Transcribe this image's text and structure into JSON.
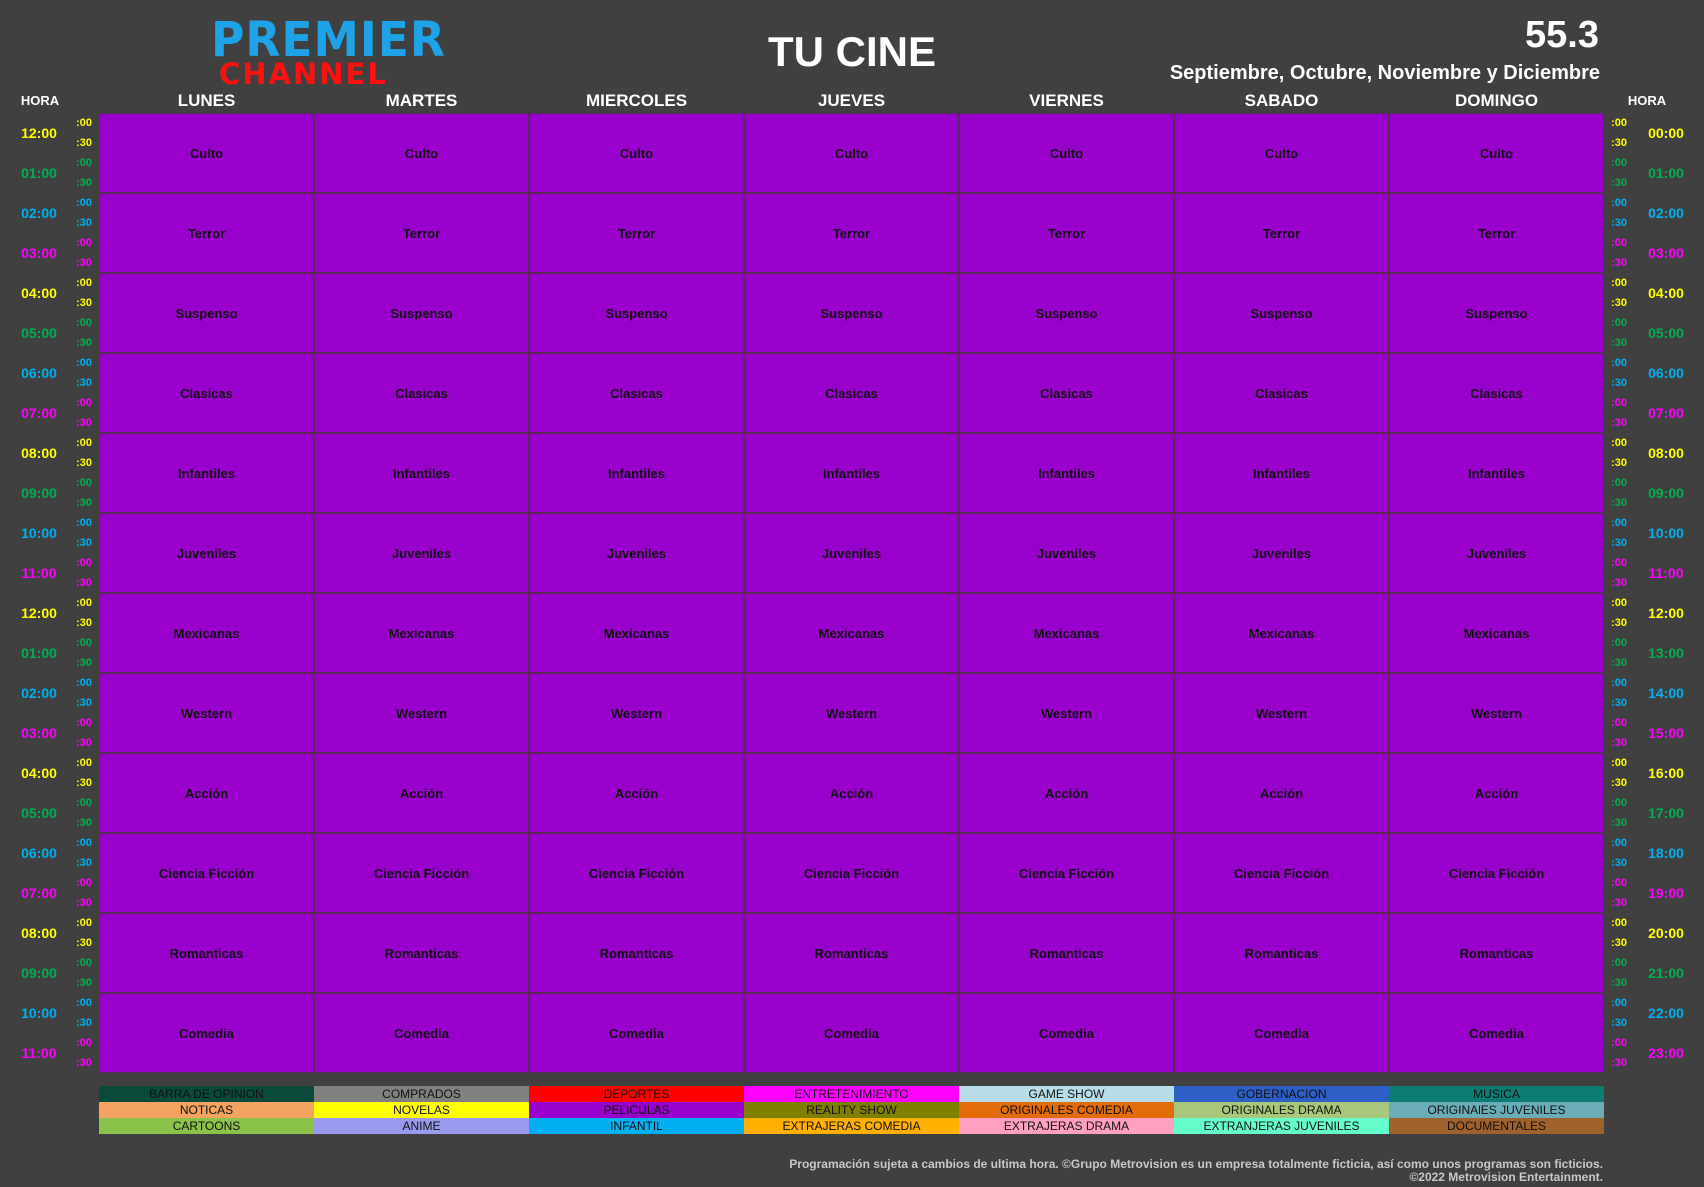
{
  "header": {
    "logo_line1": "PREMIER",
    "logo_line2": "CHANNEL",
    "title": "TU CINE",
    "channel_number": "55.3",
    "months": "Septiembre, Octubre, Noviembre y Diciembre"
  },
  "hora_label": "HORA",
  "days": [
    "LUNES",
    "MARTES",
    "MIERCOLES",
    "JUEVES",
    "VIERNES",
    "SABADO",
    "DOMINGO"
  ],
  "time_colors": [
    "#ffff00",
    "#00b050",
    "#00b0f0",
    "#ff00ff"
  ],
  "left_hours": [
    "12:00",
    "01:00",
    "02:00",
    "03:00",
    "04:00",
    "05:00",
    "06:00",
    "07:00",
    "08:00",
    "09:00",
    "10:00",
    "11:00",
    "12:00",
    "01:00",
    "02:00",
    "03:00",
    "04:00",
    "05:00",
    "06:00",
    "07:00",
    "08:00",
    "09:00",
    "10:00",
    "11:00"
  ],
  "right_hours": [
    "00:00",
    "01:00",
    "02:00",
    "03:00",
    "04:00",
    "05:00",
    "06:00",
    "07:00",
    "08:00",
    "09:00",
    "10:00",
    "11:00",
    "12:00",
    "13:00",
    "14:00",
    "15:00",
    "16:00",
    "17:00",
    "18:00",
    "19:00",
    "20:00",
    "21:00",
    "22:00",
    "23:00"
  ],
  "minute_marks": [
    ":00",
    ":30"
  ],
  "programs": [
    "Culto",
    "Terror",
    "Suspenso",
    "Clasicas",
    "Infantiles",
    "Juveniles",
    "Mexicanas",
    "Western",
    "Acción",
    "Ciencia Ficción",
    "Romanticas",
    "Comedia"
  ],
  "program_color": "#9900cc",
  "legend": [
    {
      "label": "BARRA DE OPINION",
      "color": "#0a4a3a"
    },
    {
      "label": "COMPRADOS",
      "color": "#808080"
    },
    {
      "label": "DEPORTES",
      "color": "#ff0000"
    },
    {
      "label": "ENTRETENIMIENTO",
      "color": "#ff00ff"
    },
    {
      "label": "GAME SHOW",
      "color": "#b7dee8"
    },
    {
      "label": "GOBERNACION",
      "color": "#2e5fc7"
    },
    {
      "label": "MUSICA",
      "color": "#0d7d74"
    },
    {
      "label": "NOTICAS",
      "color": "#f4a460"
    },
    {
      "label": "NOVELAS",
      "color": "#ffff00"
    },
    {
      "label": "PELICULAS",
      "color": "#9900cc"
    },
    {
      "label": "REALITY SHOW",
      "color": "#808000"
    },
    {
      "label": "ORIGINALES COMEDIA",
      "color": "#e26b0a"
    },
    {
      "label": "ORIGINALES DRAMA",
      "color": "#a9c77a"
    },
    {
      "label": "ORIGINAlES JUVENILES",
      "color": "#6aadb8"
    },
    {
      "label": "CARTOONS",
      "color": "#8bc34a"
    },
    {
      "label": "ANIME",
      "color": "#9999ee"
    },
    {
      "label": "INFANTIL",
      "color": "#00b0f0"
    },
    {
      "label": "EXTRAJERAS COMEDIA",
      "color": "#ffb000"
    },
    {
      "label": "EXTRAJERAS DRAMA",
      "color": "#ffa0c0"
    },
    {
      "label": "EXTRANJERAS JUVENILES",
      "color": "#66ffcc"
    },
    {
      "label": "DOCUMENTALES",
      "color": "#a0622d"
    }
  ],
  "footer": {
    "line1": "Programación sujeta a cambios de ultima hora. ©Grupo Metrovision es un empresa totalmente ficticia, así como unos programas son ficticios.",
    "line2": "©2022 Metrovision Entertainment."
  }
}
